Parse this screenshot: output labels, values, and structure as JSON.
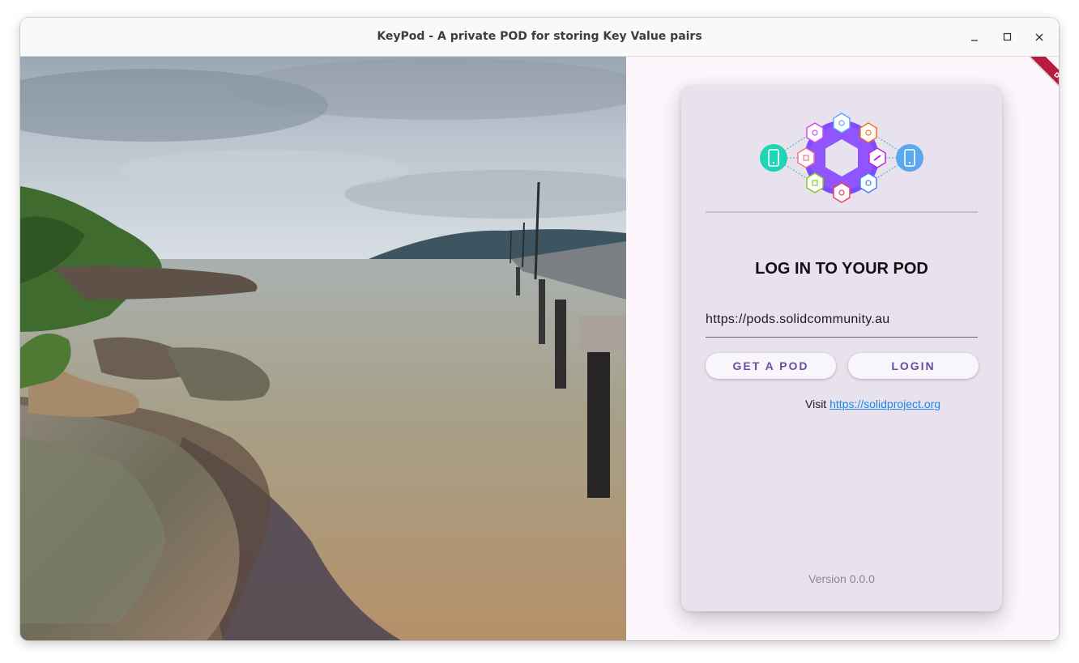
{
  "window": {
    "title": "KeyPod - A private POD for storing Key Value pairs",
    "controls": {
      "minimize_icon": "minimize-icon",
      "maximize_icon": "maximize-icon",
      "close_icon": "close-icon"
    }
  },
  "debug_banner": "DEBUG",
  "login": {
    "heading": "LOG IN TO YOUR POD",
    "server_url": "https://pods.solidcommunity.au",
    "get_pod_label": "GET A POD",
    "login_label": "LOGIN",
    "visit_prefix": "Visit",
    "visit_link": "https://solidproject.org",
    "version": "Version 0.0.0"
  },
  "colors": {
    "accent": "#654ea3",
    "card_bg": "#e8e2ef",
    "page_bg": "#fdf7fd",
    "link": "#1e88e5",
    "debug_ribbon": "#b71c3c"
  }
}
